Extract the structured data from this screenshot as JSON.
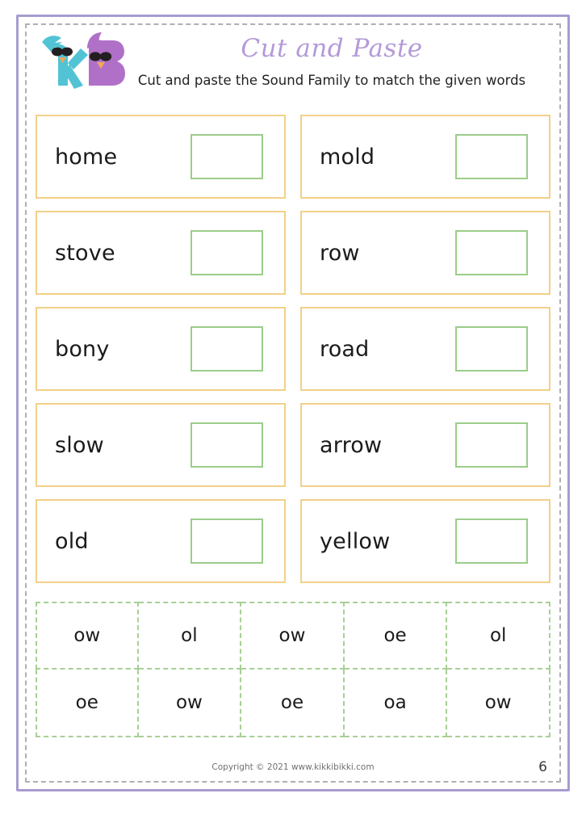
{
  "frame": {
    "outer_color": "#a79ccf",
    "inner_dash_color": "#7f7f7f"
  },
  "header": {
    "title": "Cut and Paste",
    "title_color": "#b49ad8",
    "subtitle": "Cut and paste the Sound Family to match the given words",
    "logo": {
      "letters": [
        "K",
        "B"
      ],
      "k_color": "#52c3d4",
      "b_color": "#b070c8",
      "beak_color": "#f0a85c",
      "sunglasses_color": "#231f20"
    }
  },
  "words": [
    {
      "word": "home",
      "answer": ""
    },
    {
      "word": "mold",
      "answer": ""
    },
    {
      "word": "stove",
      "answer": ""
    },
    {
      "word": "row",
      "answer": ""
    },
    {
      "word": "bony",
      "answer": ""
    },
    {
      "word": "road",
      "answer": ""
    },
    {
      "word": "slow",
      "answer": ""
    },
    {
      "word": "arrow",
      "answer": ""
    },
    {
      "word": "old",
      "answer": ""
    },
    {
      "word": "yellow",
      "answer": ""
    }
  ],
  "card_style": {
    "border_color": "#f2d08a",
    "answer_border_color": "#9ccc8a"
  },
  "tiles": {
    "border_color": "#a8cf96",
    "rows": [
      [
        "ow",
        "ol",
        "ow",
        "oe",
        "ol"
      ],
      [
        "oe",
        "ow",
        "oe",
        "oa",
        "ow"
      ]
    ]
  },
  "footer": {
    "copyright": "Copyright © 2021 www.kikkibikki.com",
    "page_number": "6"
  }
}
